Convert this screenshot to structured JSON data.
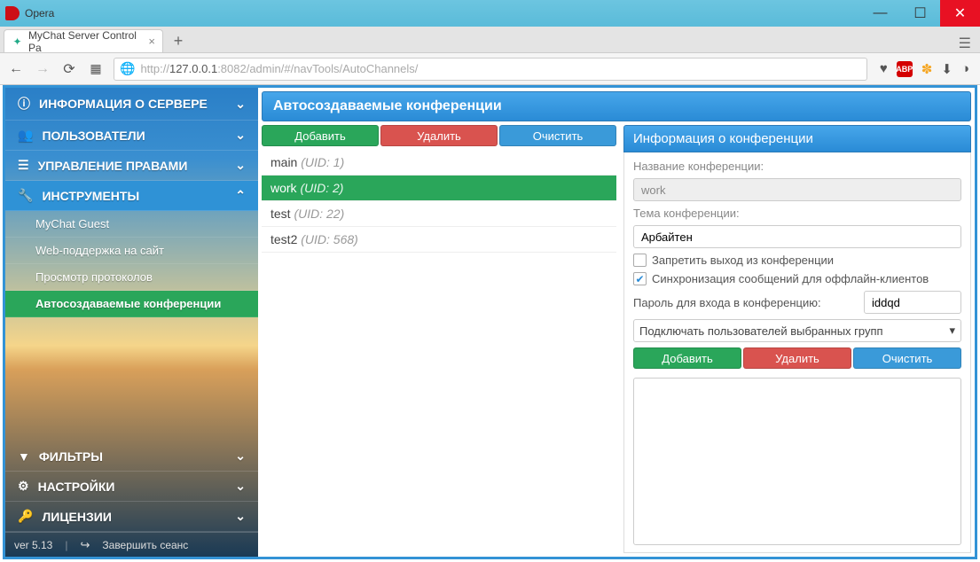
{
  "window": {
    "title": "Opera"
  },
  "tab": {
    "title": "MyChat Server Control Pa"
  },
  "url": {
    "prefix": "http://",
    "host": "127.0.0.1",
    "rest": ":8082/admin/#/navTools/AutoChannels/"
  },
  "toolbar_icons": {
    "abp": "ABP"
  },
  "sidebar": {
    "items": [
      {
        "label": "ИНФОРМАЦИЯ О СЕРВЕРЕ",
        "icon": "ⓘ"
      },
      {
        "label": "ПОЛЬЗОВАТЕЛИ",
        "icon": "👥"
      },
      {
        "label": "УПРАВЛЕНИЕ ПРАВАМИ",
        "icon": "☰"
      },
      {
        "label": "ИНСТРУМЕНТЫ",
        "icon": "🔧"
      }
    ],
    "subitems": [
      {
        "label": "MyChat Guest"
      },
      {
        "label": "Web-поддержка на сайт"
      },
      {
        "label": "Просмотр протоколов"
      },
      {
        "label": "Автосоздаваемые конференции"
      }
    ],
    "bottom": [
      {
        "label": "ФИЛЬТРЫ",
        "icon": "▾"
      },
      {
        "label": "НАСТРОЙКИ",
        "icon": "⚙"
      },
      {
        "label": "ЛИЦЕНЗИИ",
        "icon": "🔑"
      }
    ],
    "footer": {
      "version": "ver 5.13",
      "logout": "Завершить сеанс"
    }
  },
  "page": {
    "title": "Автосоздаваемые конференции"
  },
  "buttons": {
    "add": "Добавить",
    "delete": "Удалить",
    "clear": "Очистить"
  },
  "conferences": [
    {
      "name": "main",
      "uid": "(UID: 1)"
    },
    {
      "name": "work",
      "uid": "(UID: 2)"
    },
    {
      "name": "test",
      "uid": "(UID: 22)"
    },
    {
      "name": "test2",
      "uid": "(UID: 568)"
    }
  ],
  "info": {
    "panel_title": "Информация о конференции",
    "name_label": "Название конференции:",
    "name_value": "work",
    "topic_label": "Тема конференции:",
    "topic_value": "Арбайтен",
    "forbid_leave": "Запретить выход из конференции",
    "sync_offline": "Синхронизация сообщений для оффлайн-клиентов",
    "password_label": "Пароль для входа в конференцию:",
    "password_value": "iddqd",
    "select_value": "Подключать пользователей выбранных групп"
  }
}
